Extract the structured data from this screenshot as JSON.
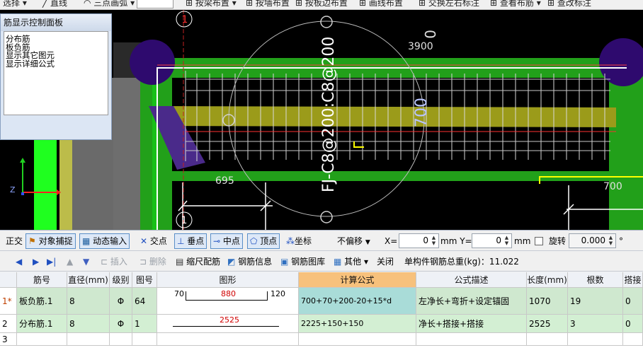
{
  "toolbar": {
    "items": [
      "选择",
      "直线",
      "三点画弧",
      "按梁布置",
      "按墙布置",
      "按板边布置",
      "画线布置",
      "交换左右标注",
      "查看布筋",
      "查改标注"
    ]
  },
  "panel": {
    "title": "筋显示控制面板",
    "items": [
      "分布筋",
      "板负筋",
      "显示其它图元",
      "显示详细公式"
    ]
  },
  "canvas": {
    "vertical_label": "FJ-C8@200:C8@200",
    "dim_3900": "3900",
    "dim_0": "0",
    "dim_700_vertical": "700",
    "dim_695": "695",
    "dim_700_right": "700",
    "axis_top": "1",
    "axis_bottom": "1"
  },
  "snapbar": {
    "ortho": "正交",
    "object_snap": "对象捕捉",
    "dynamic_input": "动态输入",
    "intersection": "交点",
    "perpendicular": "垂点",
    "midpoint": "中点",
    "vertex": "顶点",
    "coordinate": "坐标",
    "offset_mode": "不偏移",
    "x_label": "X=",
    "x_value": "0",
    "y_label": "mm Y=",
    "y_value": "0",
    "mm": "mm",
    "rotate": "旋转",
    "rotate_value": "0.000",
    "degree": "°"
  },
  "rebarbar": {
    "insert": "插入",
    "delete": "删除",
    "scale_rebar": "缩尺配筋",
    "rebar_info": "钢筋信息",
    "rebar_library": "钢筋图库",
    "other": "其他",
    "close": "关闭",
    "total_weight": "单构件钢筋总重(kg)：11.022"
  },
  "table": {
    "headers": [
      "",
      "筋号",
      "直径(mm)",
      "级别",
      "图号",
      "图形",
      "计算公式",
      "公式描述",
      "长度(mm)",
      "根数",
      "搭接"
    ],
    "rows": [
      {
        "index": "1*",
        "name": "板负筋.1",
        "diameter": "8",
        "grade": "Φ",
        "figure": "64",
        "shape_left": "70",
        "shape_mid": "880",
        "shape_right": "120",
        "formula": "700+70+200-20+15*d",
        "description": "左净长+弯折+设定锚固",
        "length": "1070",
        "count": "19",
        "lap": "0"
      },
      {
        "index": "2",
        "name": "分布筋.1",
        "diameter": "8",
        "grade": "Φ",
        "figure": "1",
        "shape_left": "",
        "shape_mid": "2525",
        "shape_right": "",
        "formula": "2225+150+150",
        "description": "净长+搭接+搭接",
        "length": "2525",
        "count": "3",
        "lap": "0"
      },
      {
        "index": "3"
      }
    ]
  },
  "colors": {
    "canvas_bg": "#000000",
    "beam_green": "#22a01a",
    "bright_green": "#1fff1f",
    "column_purple": "#2e0a6e",
    "rebar_yellow": "#bcbc1e",
    "header_highlight": "#f7c17c",
    "row_green": "#cfe8cf",
    "formula_cell": "#a9dcd8"
  }
}
